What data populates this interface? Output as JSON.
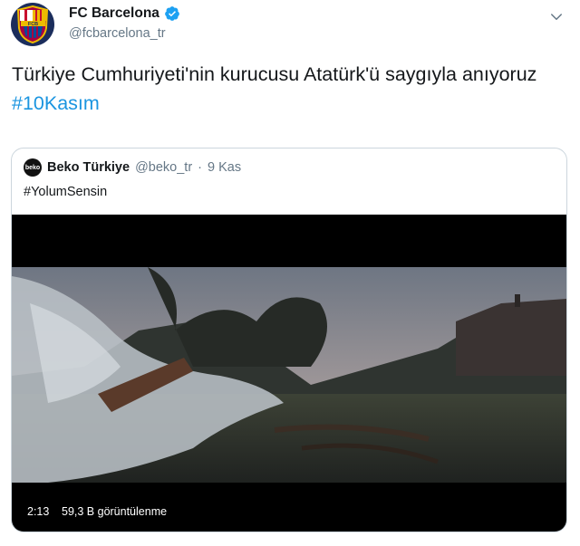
{
  "account": {
    "name": "FC Barcelona",
    "handle": "@fcbarcelona_tr",
    "avatar_text": "FCB",
    "verified_icon": "verified-badge-icon"
  },
  "tweet": {
    "text": "Türkiye Cumhuriyeti'nin kurucusu Atatürk'ü saygıyla anıyoruz ",
    "hashtag": "#10Kasım"
  },
  "quoted_tweet": {
    "logo_text": "beko",
    "name": "Beko Türkiye",
    "handle": "@beko_tr",
    "separator": "·",
    "date": "9 Kas",
    "text": "#YolumSensin"
  },
  "video": {
    "duration": "2:13",
    "views": "59,3 B görüntülenme"
  },
  "colors": {
    "accent": "#1b95e0",
    "text": "#14171a",
    "secondary": "#657786",
    "border": "#ccd6dd"
  }
}
